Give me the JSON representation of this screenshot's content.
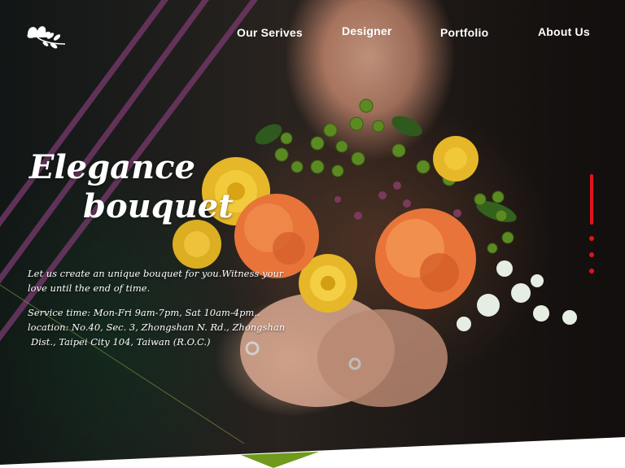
{
  "nav": {
    "items": [
      {
        "label": "Our Serives"
      },
      {
        "label": "Designer"
      },
      {
        "label": "Portfolio"
      },
      {
        "label": "About Us"
      }
    ]
  },
  "hero": {
    "title_line1": "Elegance",
    "title_line2": "bouquet",
    "tagline_line1": "Let us create an unique bouquet for you.Witness your",
    "tagline_line2": "love until the end of time.",
    "info_line1": "Service time: Mon-Fri 9am-7pm, Sat 10am-4pm,.",
    "info_line2": "location: No.40, Sec. 3, Zhongshan N. Rd., Zhongshan",
    "info_line3": "Dist., Taipei City 104, Taiwan (R.O.C.)"
  },
  "pager": {
    "total": 4,
    "active": 1
  },
  "colors": {
    "accent_red": "#e0141e",
    "stripe_purple": "#7a3a6e",
    "footer_green": "#6f9a1c"
  },
  "icons": {
    "logo": "flower-leaf-icon"
  }
}
